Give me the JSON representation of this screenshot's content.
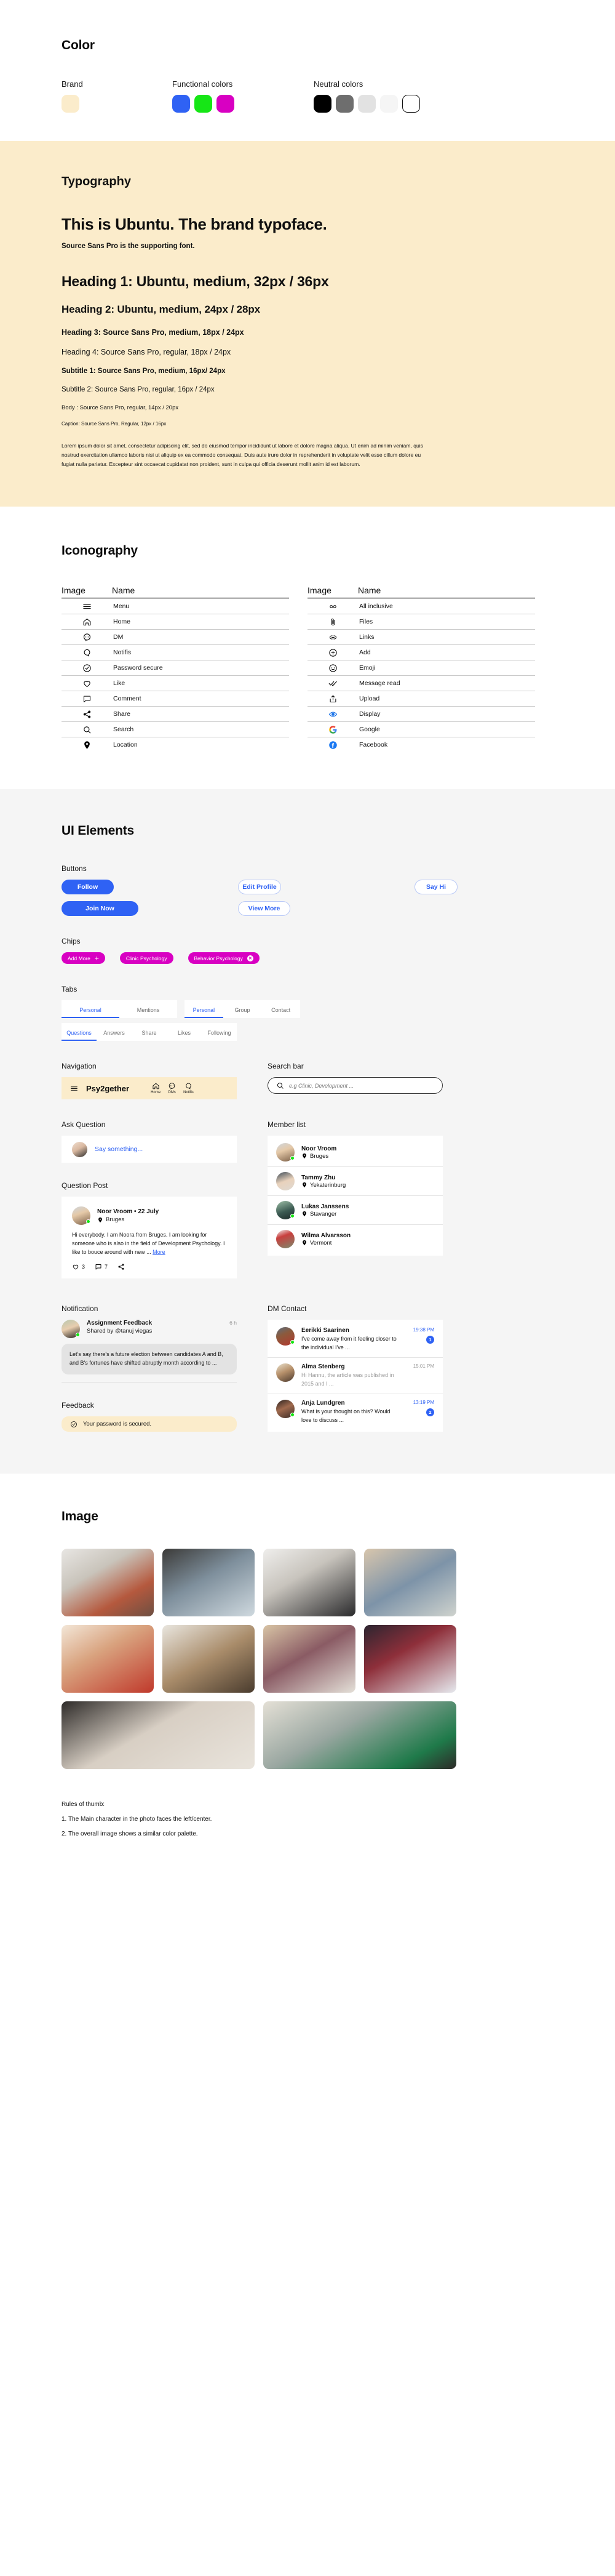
{
  "color": {
    "title": "Color",
    "groups": [
      {
        "label": "Brand",
        "swatches": [
          {
            "hex": "#fbeccb",
            "outline": false
          }
        ]
      },
      {
        "label": "Functional colors",
        "swatches": [
          {
            "hex": "#2f62f4",
            "outline": false
          },
          {
            "hex": "#16e616",
            "outline": false
          },
          {
            "hex": "#d800c2",
            "outline": false
          }
        ]
      },
      {
        "label": "Neutral colors",
        "swatches": [
          {
            "hex": "#000000",
            "outline": false
          },
          {
            "hex": "#6e6e6e",
            "outline": false
          },
          {
            "hex": "#e2e2e2",
            "outline": false
          },
          {
            "hex": "#f5f5f5",
            "outline": false
          },
          {
            "hex": "#ffffff",
            "outline": true
          }
        ]
      }
    ]
  },
  "typography": {
    "title": "Typography",
    "hero": "This is Ubuntu. The brand typoface.",
    "supporting": "Source Sans Pro is the supporting font.",
    "h1": "Heading 1: Ubuntu, medium, 32px / 36px",
    "h2": "Heading 2: Ubuntu, medium, 24px / 28px",
    "h3": "Heading 3: Source Sans Pro, medium, 18px / 24px",
    "h4": "Heading 4: Source Sans Pro, regular, 18px / 24px",
    "subtitle1": "Subtitle 1: Source Sans Pro, medium, 16px/ 24px",
    "subtitle2": "Subtitle 2: Source Sans Pro, regular, 16px / 24px",
    "body": "Body : Source Sans Pro, regular, 14px / 20px",
    "caption": "Caption: Source Sans Pro, Regular, 12px / 16px",
    "paragraph": "Lorem ipsum dolor sit amet, consectetur adipiscing elit, sed do eiusmod tempor incididunt ut labore et dolore magna aliqua. Ut enim ad minim veniam, quis nostrud exercitation ullamco laboris nisi ut aliquip ex ea commodo consequat. Duis aute irure dolor in reprehenderit in voluptate velit esse cillum dolore eu fugiat nulla pariatur. Excepteur sint occaecat cupidatat non proident, sunt in culpa qui officia deserunt mollit anim id est laborum."
  },
  "iconography": {
    "title": "Iconography",
    "col_image": "Image",
    "col_name": "Name",
    "left": [
      {
        "icon": "menu-icon",
        "name": "Menu"
      },
      {
        "icon": "home-icon",
        "name": "Home"
      },
      {
        "icon": "dm-icon",
        "name": "DM"
      },
      {
        "icon": "notifications-icon",
        "name": "Notifis"
      },
      {
        "icon": "check-circle-icon",
        "name": "Password secure"
      },
      {
        "icon": "heart-icon",
        "name": "Like"
      },
      {
        "icon": "comment-icon",
        "name": "Comment"
      },
      {
        "icon": "share-icon",
        "name": "Share"
      },
      {
        "icon": "search-icon",
        "name": "Search"
      },
      {
        "icon": "location-pin-icon",
        "name": "Location"
      }
    ],
    "right": [
      {
        "icon": "infinity-icon",
        "name": "All inclusive"
      },
      {
        "icon": "paperclip-icon",
        "name": "Files"
      },
      {
        "icon": "link-icon",
        "name": "Links"
      },
      {
        "icon": "plus-circle-icon",
        "name": "Add"
      },
      {
        "icon": "emoji-icon",
        "name": "Emoji"
      },
      {
        "icon": "double-check-icon",
        "name": "Message read"
      },
      {
        "icon": "upload-icon",
        "name": "Upload"
      },
      {
        "icon": "eye-icon",
        "name": "Display"
      },
      {
        "icon": "google-icon",
        "name": "Google"
      },
      {
        "icon": "facebook-icon",
        "name": "Facebook"
      }
    ]
  },
  "ui": {
    "title": "UI Elements",
    "buttons_label": "Buttons",
    "buttons": {
      "follow": "Follow",
      "edit_profile": "Edit Profile",
      "say_hi": "Say Hi",
      "join_now": "Join Now",
      "view_more": "View More"
    },
    "chips_label": "Chips",
    "chips": [
      {
        "label": "Add More",
        "trailing": "plus"
      },
      {
        "label": "Clinic Psychology",
        "trailing": "none"
      },
      {
        "label": "Behavior Psychology",
        "trailing": "close"
      }
    ],
    "tabs_label": "Tabs",
    "tabset_a": [
      {
        "label": "Personal",
        "active": true
      },
      {
        "label": "Mentions",
        "active": false
      }
    ],
    "tabset_b": [
      {
        "label": "Personal",
        "active": true
      },
      {
        "label": "Group",
        "active": false
      },
      {
        "label": "Contact",
        "active": false
      }
    ],
    "tabset_c": [
      {
        "label": "Questions",
        "active": true
      },
      {
        "label": "Answers",
        "active": false
      },
      {
        "label": "Share",
        "active": false
      },
      {
        "label": "Likes",
        "active": false
      },
      {
        "label": "Following",
        "active": false
      }
    ],
    "navigation_label": "Navigation",
    "nav": {
      "brand": "Psy2gether",
      "items": [
        {
          "icon": "home-icon",
          "label": "Home"
        },
        {
          "icon": "dm-icon",
          "label": "DMs"
        },
        {
          "icon": "notifications-icon",
          "label": "Notifis"
        }
      ]
    },
    "search_label": "Search bar",
    "search_placeholder": "e.g Clinic, Development ...",
    "ask_label": "Ask Question",
    "ask_placeholder": "Say something...",
    "question_post_label": "Question Post",
    "post": {
      "name": "Noor Vroom",
      "separator": "•",
      "date": "22 July",
      "location": "Bruges",
      "body": "Hi everybody. I am Noora from Bruges. I am looking for someone who is also in the field of Development Psychology. I like to bouce around with new ...",
      "more": "More",
      "likes": "3",
      "comments": "7"
    },
    "member_label": "Member list",
    "members": [
      {
        "name": "Noor Vroom",
        "location": "Bruges",
        "online": true
      },
      {
        "name": "Tammy Zhu",
        "location": "Yekaterinburg",
        "online": false
      },
      {
        "name": "Lukas Janssens",
        "location": "Stavanger",
        "online": true
      },
      {
        "name": "Wilma Alvarsson",
        "location": "Vermont",
        "online": false
      }
    ],
    "notification_label": "Notification",
    "notification": {
      "title": "Assignment Feedback",
      "subtitle": "Shared by @tanuj viegas",
      "time": "6 h",
      "message": "Let’s say there's a future election between candidates A and B, and B's fortunes have shifted abruptly month according to ..."
    },
    "feedback_label": "Feedback",
    "feedback_message": "Your password is secured.",
    "dm_label": "DM Contact",
    "dms": [
      {
        "name": "Eerikki Saarinen",
        "message": "I've come away from it feeling closer to the individual I've ...",
        "time": "19:38 PM",
        "badge": "1",
        "unread": true,
        "online": true
      },
      {
        "name": "Alma Stenberg",
        "message": "Hi Hannu, the article was published in 2015 and I ...",
        "time": "15:01 PM",
        "badge": "",
        "unread": false,
        "online": false
      },
      {
        "name": "Anja Lundgren",
        "message": "What is your thought on this? Would love to discuss ...",
        "time": "13:19 PM",
        "badge": "2",
        "unread": true,
        "online": true
      }
    ]
  },
  "image_section": {
    "title": "Image",
    "rules_title": "Rules of thumb:",
    "rules": [
      "1. The Main character in the photo faces the left/center.",
      "2. The overall image shows a similar color palette."
    ]
  }
}
